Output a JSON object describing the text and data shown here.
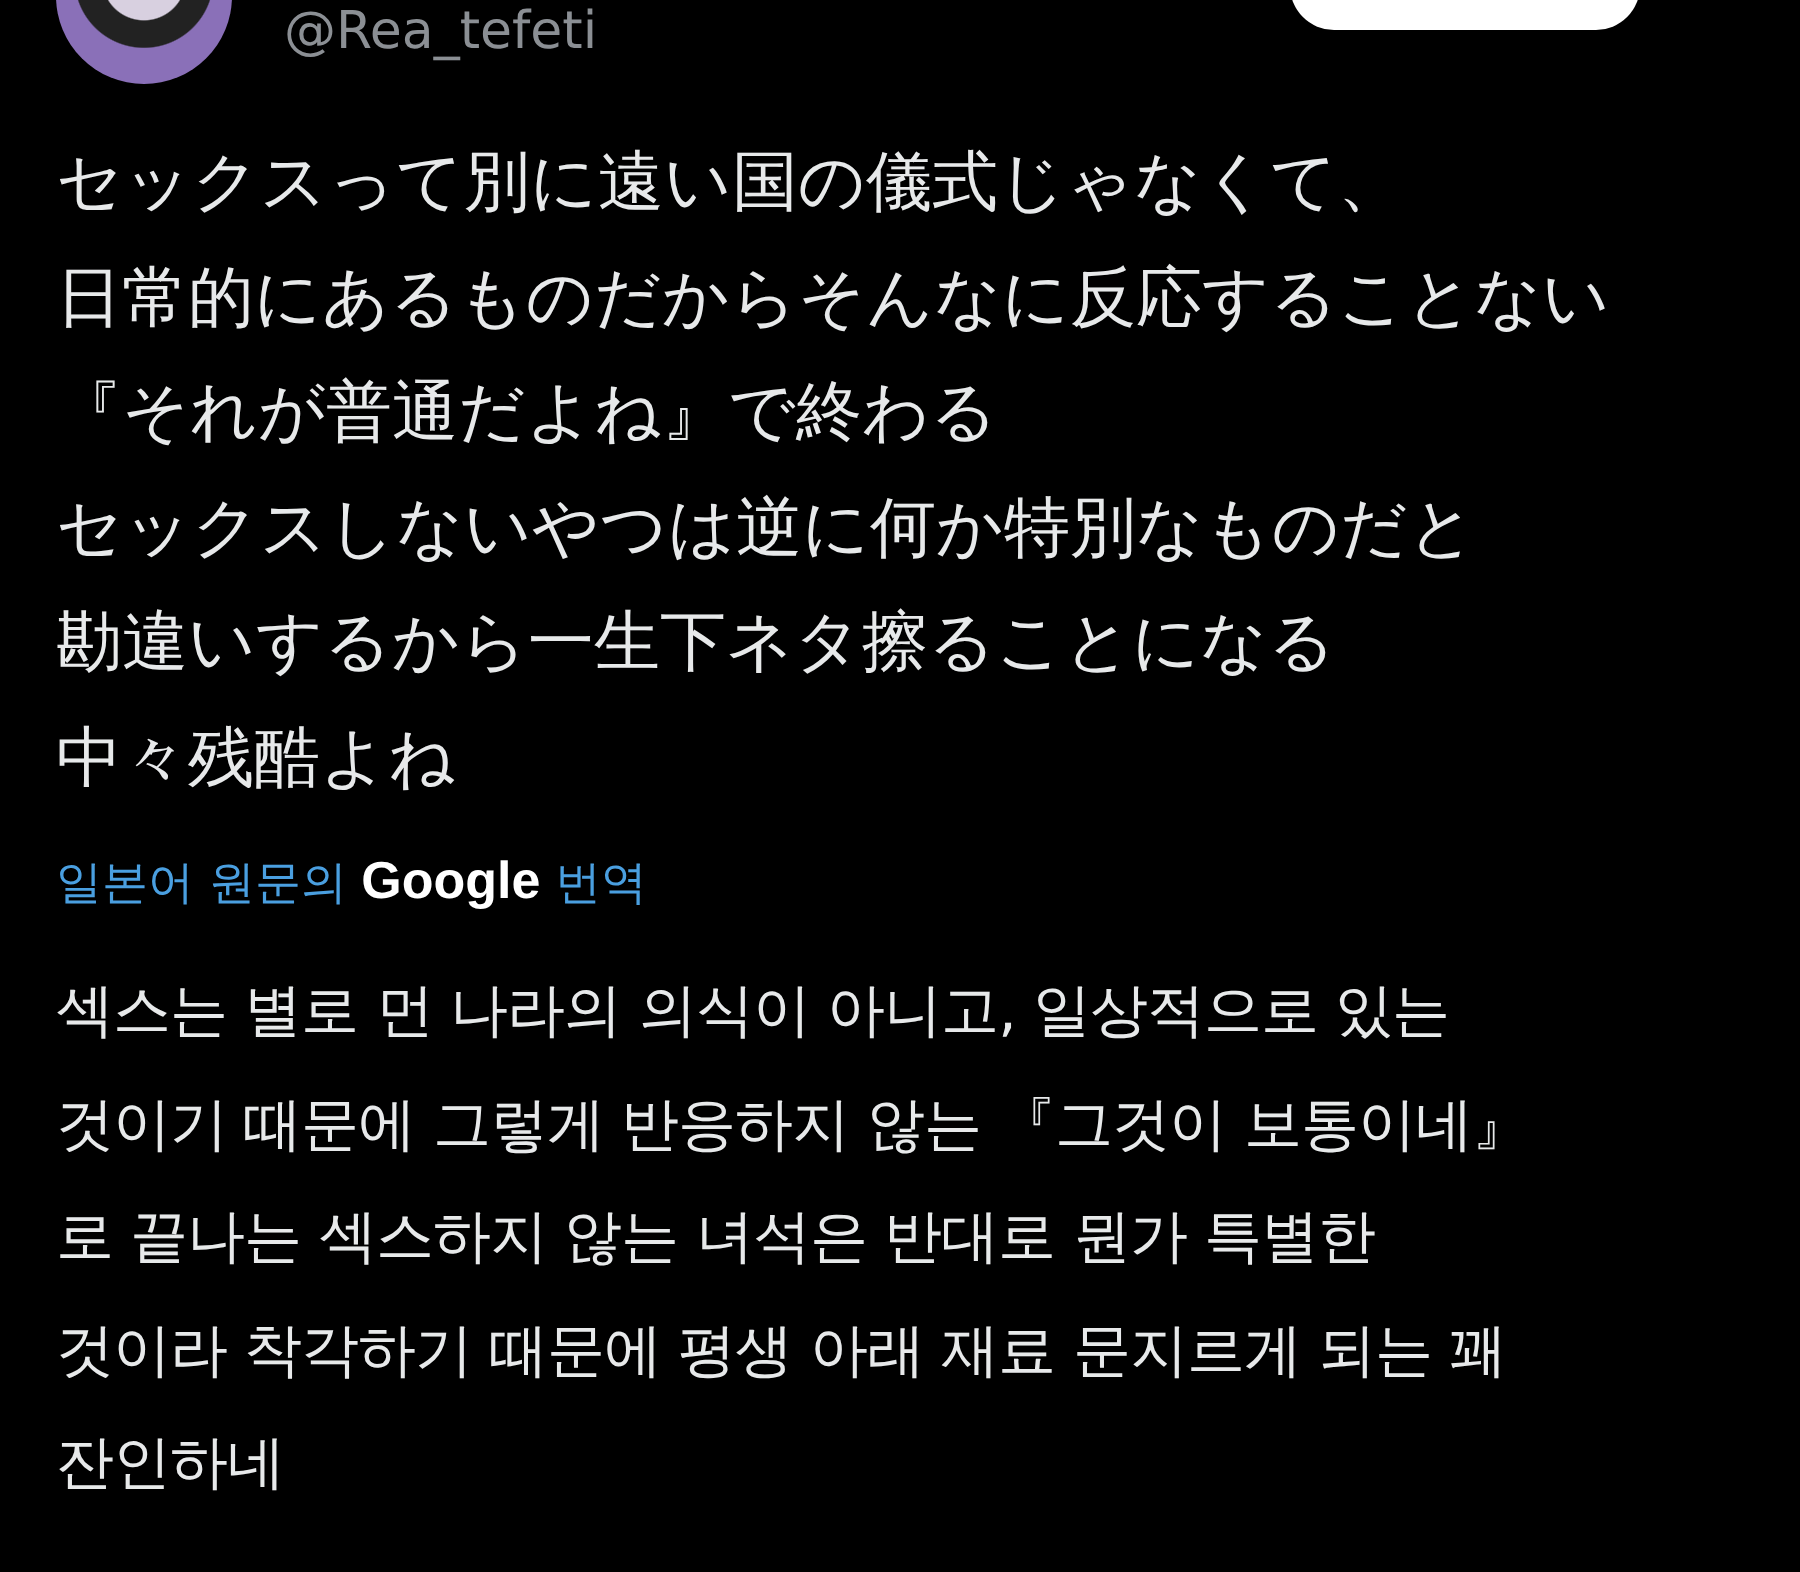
{
  "author": {
    "handle": "@Rea_tefeti"
  },
  "post": {
    "lines": [
      "セックスって別に遠い国の儀式じゃなくて、",
      "日常的にあるものだからそんなに反応することない",
      "『それが普通だよね』で終わる",
      "セックスしないやつは逆に何か特別なものだと",
      "勘違いするから一生下ネタ擦ることになる",
      "中々残酷よね"
    ]
  },
  "translation": {
    "note": "일본어 원문의 **Google** 번역",
    "lines": [
      "섹스는 별로 먼 나라의 의식이 아니고, 일상적으로 있는",
      "것이기 때문에 그렇게 반응하지 않는 『그것이 보통이네』",
      "로 끝나는 섹스하지 않는 녀석은 반대로 뭔가 특별한",
      "것이라 착각하기 때문에 평생 아래 재료 문지르게 되는 꽤",
      "잔인하네"
    ]
  }
}
